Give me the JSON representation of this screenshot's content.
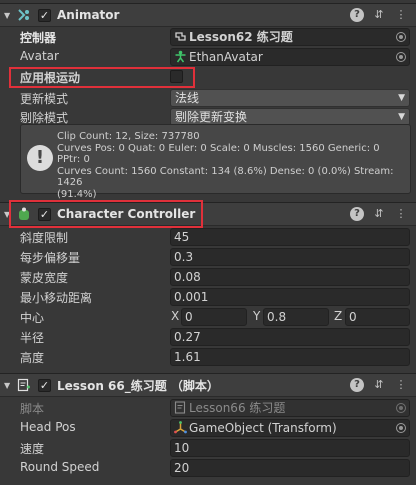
{
  "animator": {
    "title": "Animator",
    "rows": {
      "controller_label": "控制器",
      "controller_value": "Lesson62 练习题",
      "avatar_label": "Avatar",
      "avatar_value": "EthanAvatar",
      "root_motion_label": "应用根运动",
      "update_mode_label": "更新模式",
      "update_mode_value": "法线",
      "culling_mode_label": "剔除模式",
      "culling_mode_value": "剔除更新变换"
    },
    "info": "Clip Count: 12, Size: 737780\nCurves Pos: 0 Quat: 0 Euler: 0 Scale: 0 Muscles: 1560 Generic: 0 PPtr: 0\nCurves Count: 1560 Constant: 134 (8.6%) Dense: 0 (0.0%) Stream: 1426\n(91.4%)"
  },
  "character_controller": {
    "title": "Character Controller",
    "slope_label": "斜度限制",
    "slope_value": "45",
    "step_label": "每步偏移量",
    "step_value": "0.3",
    "skin_label": "蒙皮宽度",
    "skin_value": "0.08",
    "min_move_label": "最小移动距离",
    "min_move_value": "0.001",
    "center_label": "中心",
    "center": {
      "x_label": "X",
      "x": "0",
      "y_label": "Y",
      "y": "0.8",
      "z_label": "Z",
      "z": "0"
    },
    "radius_label": "半径",
    "radius_value": "0.27",
    "height_label": "高度",
    "height_value": "1.61"
  },
  "script_comp": {
    "title": "Lesson 66_练习题 （脚本）",
    "script_label": "脚本",
    "script_value": "Lesson66 练习题",
    "head_pos_label": "Head Pos",
    "head_pos_value": "GameObject (Transform)",
    "speed_label": "速度",
    "speed_value": "10",
    "round_speed_label": "Round Speed",
    "round_speed_value": "20"
  },
  "header_icons": {
    "help": "?",
    "presets": "⇵",
    "menu": "⋮"
  },
  "colors": {
    "highlight": "#e0303a",
    "panel": "#383838",
    "header": "#3e3e3e",
    "field": "#2a2a2a"
  }
}
